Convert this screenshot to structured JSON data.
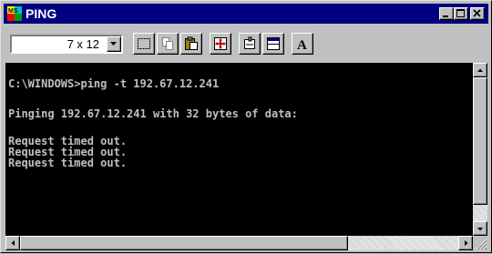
{
  "window": {
    "title": "PING",
    "icon": "ms-dos-icon",
    "controls": [
      "minimize-icon",
      "maximize-icon",
      "close-icon"
    ]
  },
  "toolbar": {
    "font_size": "7 x 12",
    "buttons": [
      {
        "name": "mark-button",
        "icon": "mark-icon"
      },
      {
        "name": "copy-button",
        "icon": "copy-icon"
      },
      {
        "name": "paste-button",
        "icon": "paste-icon"
      },
      {
        "name": "fullscreen-button",
        "icon": "fullscreen-icon"
      },
      {
        "name": "properties-button",
        "icon": "properties-icon"
      },
      {
        "name": "background-button",
        "icon": "background-icon"
      },
      {
        "name": "font-button",
        "icon": "font-icon",
        "label": "A"
      }
    ]
  },
  "console": {
    "lines": [
      "C:\\WINDOWS>ping -t 192.67.12.241",
      "Pinging 192.67.12.241 with 32 bytes of data:",
      "Request timed out.",
      "Request timed out.",
      "Request timed out."
    ]
  },
  "colors": {
    "title_bar": "#000080",
    "console_bg": "#000000",
    "console_text": "#c0c0c0",
    "chrome": "#c0c0c0"
  }
}
